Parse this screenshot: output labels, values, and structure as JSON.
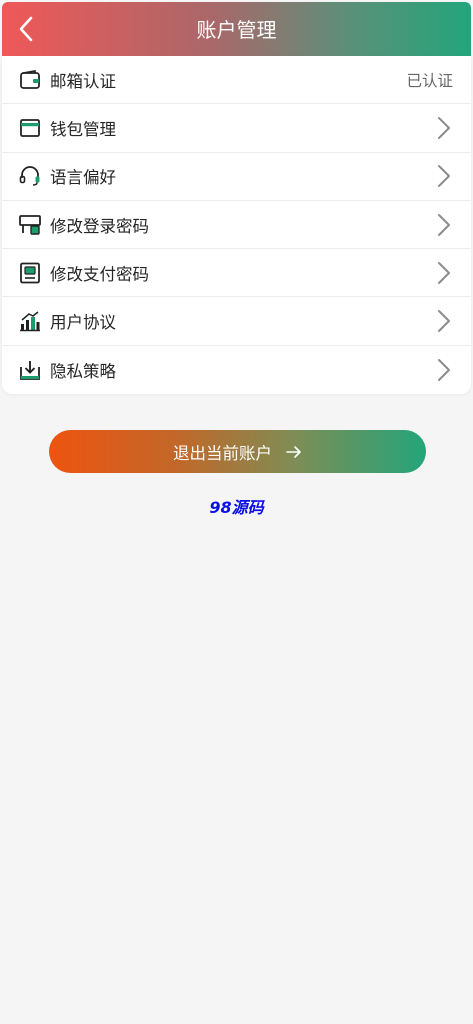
{
  "header": {
    "title": "账户管理",
    "back_icon": "chevron-left-icon"
  },
  "menu": {
    "items": [
      {
        "label": "邮箱认证",
        "icon": "wallet-icon",
        "status": "已认证"
      },
      {
        "label": "钱包管理",
        "icon": "card-icon"
      },
      {
        "label": "语言偏好",
        "icon": "headset-icon"
      },
      {
        "label": "修改登录密码",
        "icon": "lock-monitor-icon"
      },
      {
        "label": "修改支付密码",
        "icon": "payment-box-icon"
      },
      {
        "label": "用户协议",
        "icon": "signal-bars-icon"
      },
      {
        "label": "隐私策略",
        "icon": "download-icon"
      }
    ],
    "arrow_icon": "chevron-right-icon"
  },
  "logout": {
    "label": "退出当前账户",
    "icon": "arrow-right-icon"
  },
  "brand": {
    "text": "98源码",
    "color": "#0b10e8"
  },
  "colors": {
    "header_start": "#f05858",
    "header_end": "#23a57b",
    "accent_green": "#23a57b",
    "button_start": "#ee5410"
  }
}
